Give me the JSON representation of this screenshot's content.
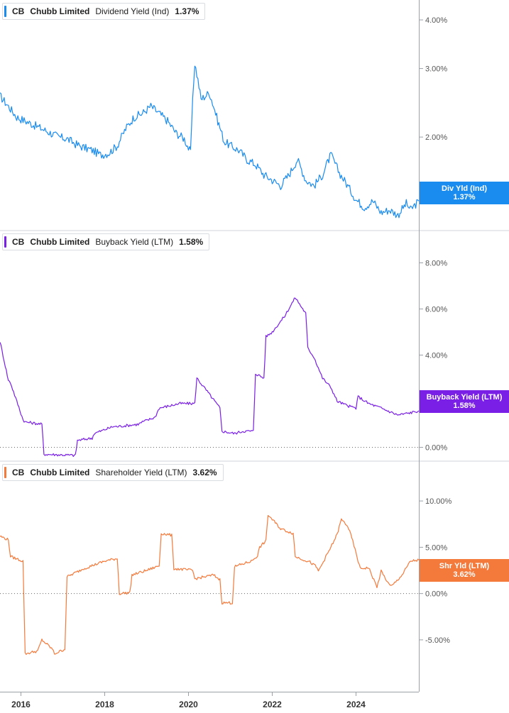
{
  "chart_data": [
    {
      "type": "line",
      "ticker": "CB",
      "company": "Chubb Limited",
      "metric": "Dividend Yield (Ind)",
      "current": "1.37%",
      "tag_label": "Div Yld (Ind)",
      "color": "#1a8cf0",
      "y_ticks": [
        2,
        3,
        4
      ],
      "y_tick_labels": [
        "2.00%",
        "3.00%",
        "4.00%"
      ],
      "y_scale": "log",
      "ylim": [
        1.15,
        4.5
      ],
      "zero_line": false,
      "x": [
        2015.5,
        2015.7,
        2015.9,
        2016.1,
        2016.3,
        2016.5,
        2016.7,
        2016.9,
        2017.1,
        2017.3,
        2017.5,
        2017.7,
        2017.9,
        2018.1,
        2018.3,
        2018.5,
        2018.7,
        2018.9,
        2019.1,
        2019.3,
        2019.5,
        2019.7,
        2019.9,
        2020.05,
        2020.15,
        2020.3,
        2020.5,
        2020.7,
        2020.85,
        2021.0,
        2021.2,
        2021.4,
        2021.6,
        2021.8,
        2022.0,
        2022.2,
        2022.4,
        2022.6,
        2022.8,
        2023.0,
        2023.2,
        2023.4,
        2023.6,
        2023.8,
        2024.0,
        2024.2,
        2024.4,
        2024.6,
        2024.8,
        2025.0,
        2025.2,
        2025.3,
        2025.5
      ],
      "values": [
        2.55,
        2.4,
        2.25,
        2.2,
        2.15,
        2.1,
        2.05,
        2.0,
        1.98,
        1.92,
        1.88,
        1.85,
        1.8,
        1.82,
        1.9,
        2.1,
        2.25,
        2.3,
        2.4,
        2.3,
        2.2,
        2.05,
        1.98,
        1.82,
        3.1,
        2.5,
        2.6,
        2.2,
        1.95,
        1.9,
        1.85,
        1.75,
        1.7,
        1.6,
        1.55,
        1.5,
        1.6,
        1.75,
        1.55,
        1.5,
        1.6,
        1.8,
        1.62,
        1.5,
        1.38,
        1.32,
        1.37,
        1.28,
        1.3,
        1.26,
        1.35,
        1.3,
        1.37
      ]
    },
    {
      "type": "line",
      "ticker": "CB",
      "company": "Chubb Limited",
      "metric": "Buyback Yield (LTM)",
      "current": "1.58%",
      "tag_label": "Buyback Yield (LTM)",
      "color": "#7a1fe6",
      "y_ticks": [
        0,
        2,
        4,
        6,
        8
      ],
      "y_tick_labels": [
        "0.00%",
        "2.00%",
        "4.00%",
        "6.00%",
        "8.00%"
      ],
      "y_scale": "linear",
      "ylim": [
        -0.6,
        9.4
      ],
      "zero_line": true,
      "x": [
        2015.5,
        2015.7,
        2015.75,
        2016.05,
        2016.1,
        2016.5,
        2016.55,
        2017.3,
        2017.35,
        2017.7,
        2017.75,
        2018.2,
        2018.3,
        2018.8,
        2018.9,
        2019.2,
        2019.3,
        2019.8,
        2020.15,
        2020.2,
        2020.5,
        2020.75,
        2020.8,
        2021.1,
        2021.3,
        2021.55,
        2021.6,
        2021.8,
        2021.85,
        2022.0,
        2022.3,
        2022.55,
        2022.8,
        2022.85,
        2023.0,
        2023.2,
        2023.4,
        2023.55,
        2023.8,
        2024.0,
        2024.05,
        2024.3,
        2024.6,
        2025.0,
        2025.3,
        2025.5
      ],
      "values": [
        4.6,
        2.9,
        2.8,
        1.2,
        1.1,
        1.0,
        -0.3,
        -0.35,
        0.3,
        0.4,
        0.6,
        0.9,
        0.9,
        1.0,
        1.1,
        1.3,
        1.7,
        1.9,
        1.9,
        3.0,
        2.3,
        1.7,
        0.7,
        0.6,
        0.7,
        0.7,
        3.2,
        3.0,
        4.8,
        5.0,
        5.7,
        6.5,
        5.8,
        4.3,
        3.9,
        3.0,
        2.6,
        2.0,
        1.8,
        1.7,
        2.2,
        1.9,
        1.7,
        1.4,
        1.5,
        1.58
      ]
    },
    {
      "type": "line",
      "ticker": "CB",
      "company": "Chubb Limited",
      "metric": "Shareholder Yield (LTM)",
      "current": "3.62%",
      "tag_label": "Shr Yld (LTM)",
      "color": "#f47a3c",
      "y_ticks": [
        -5,
        0,
        5,
        10
      ],
      "y_tick_labels": [
        "-5.00%",
        "0.00%",
        "5.00%",
        "10.00%"
      ],
      "y_scale": "linear",
      "ylim": [
        -10.6,
        14.3
      ],
      "zero_line": true,
      "x": [
        2015.5,
        2015.7,
        2015.75,
        2016.05,
        2016.1,
        2016.4,
        2016.5,
        2016.75,
        2016.8,
        2017.05,
        2017.1,
        2017.5,
        2018.0,
        2018.3,
        2018.35,
        2018.6,
        2018.65,
        2019.0,
        2019.3,
        2019.35,
        2019.6,
        2019.65,
        2020.1,
        2020.15,
        2020.6,
        2020.75,
        2020.8,
        2021.05,
        2021.1,
        2021.5,
        2021.65,
        2021.7,
        2021.85,
        2021.9,
        2022.2,
        2022.5,
        2022.55,
        2022.9,
        2023.05,
        2023.1,
        2023.4,
        2023.55,
        2023.65,
        2023.8,
        2023.9,
        2024.1,
        2024.3,
        2024.5,
        2024.6,
        2024.8,
        2024.85,
        2025.1,
        2025.3,
        2025.5
      ],
      "values": [
        6.2,
        5.8,
        4.0,
        3.5,
        -6.5,
        -6.2,
        -5.0,
        -6.0,
        -6.5,
        -6.0,
        1.8,
        2.7,
        3.5,
        3.8,
        0.0,
        0.1,
        2.0,
        2.5,
        3.0,
        6.5,
        6.3,
        2.7,
        2.5,
        1.6,
        2.0,
        1.5,
        -1.0,
        -1.0,
        2.9,
        3.5,
        4.1,
        5.0,
        5.7,
        8.5,
        7.0,
        6.5,
        4.0,
        3.4,
        2.9,
        2.4,
        5.0,
        6.4,
        8.0,
        7.3,
        6.0,
        2.7,
        2.8,
        0.7,
        2.4,
        0.9,
        0.8,
        2.0,
        3.5,
        3.62
      ]
    }
  ],
  "x_axis": {
    "ticks": [
      2016,
      2018,
      2020,
      2022,
      2024
    ],
    "labels": [
      "2016",
      "2018",
      "2020",
      "2022",
      "2024"
    ],
    "xlim": [
      2015.5,
      2025.5
    ]
  }
}
